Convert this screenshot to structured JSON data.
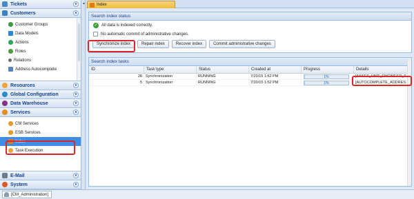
{
  "sidebar": {
    "groups_top": [
      {
        "label": "Tickets",
        "icon": "ticket-icon",
        "color": "#4a88c9"
      },
      {
        "label": "Customers",
        "icon": "customers-icon",
        "color": "#3d7fc7"
      }
    ],
    "customer_items": [
      {
        "label": "Customer Groups",
        "icon": "customer-groups-icon",
        "color": "#3c9a3c"
      },
      {
        "label": "Data Models",
        "icon": "data-models-icon",
        "color": "#2f87d1"
      },
      {
        "label": "Actions",
        "icon": "actions-icon",
        "color": "#2aa55a"
      },
      {
        "label": "Roles",
        "icon": "roles-icon",
        "color": "#4e9a3f"
      },
      {
        "label": "Relations",
        "icon": "relations-icon",
        "color": "#6b6b6b"
      },
      {
        "label": "Address Autocomplete",
        "icon": "address-autocomplete-icon",
        "color": "#5a83b8"
      }
    ],
    "groups_mid": [
      {
        "label": "Resources",
        "icon": "resources-icon",
        "color": "#f0a53c"
      },
      {
        "label": "Global Configuration",
        "icon": "global-config-icon",
        "color": "#2b8ac9"
      },
      {
        "label": "Data Warehouse",
        "icon": "data-warehouse-icon",
        "color": "#8a2f8a"
      },
      {
        "label": "Services",
        "icon": "services-icon",
        "color": "#e58b1f"
      }
    ],
    "service_items": [
      {
        "label": "CM Services",
        "icon": "cm-services-icon",
        "color": "#e59a2e"
      },
      {
        "label": "ESB Services",
        "icon": "esb-services-icon",
        "color": "#e59a2e"
      },
      {
        "label": "Index",
        "icon": "index-icon",
        "color": "#e07a19",
        "selected": true
      },
      {
        "label": "Task Execution",
        "icon": "task-execution-icon",
        "color": "#f0a53c"
      }
    ],
    "groups_bottom": [
      {
        "label": "E-Mail",
        "icon": "email-icon",
        "color": "#6b7b8c"
      },
      {
        "label": "System",
        "icon": "system-icon",
        "color": "#d9582b"
      }
    ]
  },
  "tab": {
    "label": "Index"
  },
  "status_panel": {
    "title": "Search index status",
    "indexed_text": "All data is indexed correctly.",
    "no_auto_commit": "No automatic commit of administrative changes.",
    "buttons": [
      "Synchronize index",
      "Repair index",
      "Recover index",
      "Commit administrative changes"
    ]
  },
  "tasks_panel": {
    "title": "Search index tasks",
    "columns": [
      "ID",
      "Task type",
      "Status",
      "Created at",
      "Progress",
      "Details"
    ],
    "rows": [
      {
        "id": "28",
        "type": "Synchronization",
        "status": "RUNNING",
        "created": "7/20/15 1:52 PM",
        "progress": 0.01,
        "progress_label": "1%",
        "details": "[ASSET_UNIT_ENGINEER_T..."
      },
      {
        "id": "5",
        "type": "Synchronization",
        "status": "RUNNING",
        "created": "7/20/15 1:52 PM",
        "progress": 0.01,
        "progress_label": "1%",
        "details": "[AUTOCOMPLETE_ADDRES..."
      }
    ]
  },
  "statusbar": {
    "user": "[CM_Administration]"
  }
}
